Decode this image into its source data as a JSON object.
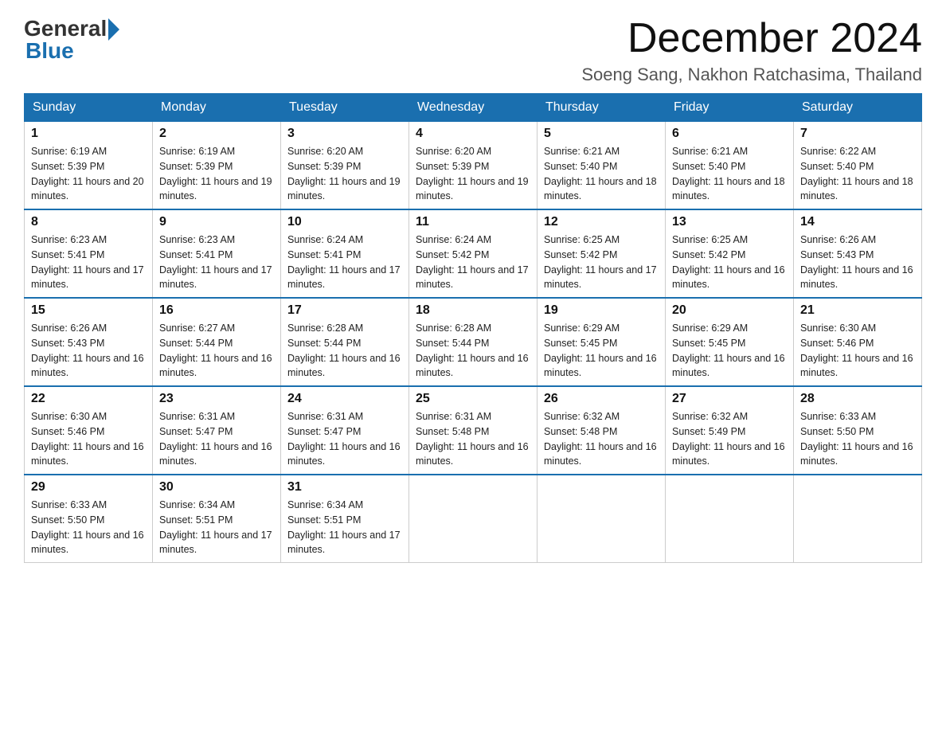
{
  "logo": {
    "general": "General",
    "blue": "Blue"
  },
  "header": {
    "title": "December 2024",
    "subtitle": "Soeng Sang, Nakhon Ratchasima, Thailand"
  },
  "days_of_week": [
    "Sunday",
    "Monday",
    "Tuesday",
    "Wednesday",
    "Thursday",
    "Friday",
    "Saturday"
  ],
  "weeks": [
    [
      {
        "day": "1",
        "sunrise": "6:19 AM",
        "sunset": "5:39 PM",
        "daylight": "11 hours and 20 minutes."
      },
      {
        "day": "2",
        "sunrise": "6:19 AM",
        "sunset": "5:39 PM",
        "daylight": "11 hours and 19 minutes."
      },
      {
        "day": "3",
        "sunrise": "6:20 AM",
        "sunset": "5:39 PM",
        "daylight": "11 hours and 19 minutes."
      },
      {
        "day": "4",
        "sunrise": "6:20 AM",
        "sunset": "5:39 PM",
        "daylight": "11 hours and 19 minutes."
      },
      {
        "day": "5",
        "sunrise": "6:21 AM",
        "sunset": "5:40 PM",
        "daylight": "11 hours and 18 minutes."
      },
      {
        "day": "6",
        "sunrise": "6:21 AM",
        "sunset": "5:40 PM",
        "daylight": "11 hours and 18 minutes."
      },
      {
        "day": "7",
        "sunrise": "6:22 AM",
        "sunset": "5:40 PM",
        "daylight": "11 hours and 18 minutes."
      }
    ],
    [
      {
        "day": "8",
        "sunrise": "6:23 AM",
        "sunset": "5:41 PM",
        "daylight": "11 hours and 17 minutes."
      },
      {
        "day": "9",
        "sunrise": "6:23 AM",
        "sunset": "5:41 PM",
        "daylight": "11 hours and 17 minutes."
      },
      {
        "day": "10",
        "sunrise": "6:24 AM",
        "sunset": "5:41 PM",
        "daylight": "11 hours and 17 minutes."
      },
      {
        "day": "11",
        "sunrise": "6:24 AM",
        "sunset": "5:42 PM",
        "daylight": "11 hours and 17 minutes."
      },
      {
        "day": "12",
        "sunrise": "6:25 AM",
        "sunset": "5:42 PM",
        "daylight": "11 hours and 17 minutes."
      },
      {
        "day": "13",
        "sunrise": "6:25 AM",
        "sunset": "5:42 PM",
        "daylight": "11 hours and 16 minutes."
      },
      {
        "day": "14",
        "sunrise": "6:26 AM",
        "sunset": "5:43 PM",
        "daylight": "11 hours and 16 minutes."
      }
    ],
    [
      {
        "day": "15",
        "sunrise": "6:26 AM",
        "sunset": "5:43 PM",
        "daylight": "11 hours and 16 minutes."
      },
      {
        "day": "16",
        "sunrise": "6:27 AM",
        "sunset": "5:44 PM",
        "daylight": "11 hours and 16 minutes."
      },
      {
        "day": "17",
        "sunrise": "6:28 AM",
        "sunset": "5:44 PM",
        "daylight": "11 hours and 16 minutes."
      },
      {
        "day": "18",
        "sunrise": "6:28 AM",
        "sunset": "5:44 PM",
        "daylight": "11 hours and 16 minutes."
      },
      {
        "day": "19",
        "sunrise": "6:29 AM",
        "sunset": "5:45 PM",
        "daylight": "11 hours and 16 minutes."
      },
      {
        "day": "20",
        "sunrise": "6:29 AM",
        "sunset": "5:45 PM",
        "daylight": "11 hours and 16 minutes."
      },
      {
        "day": "21",
        "sunrise": "6:30 AM",
        "sunset": "5:46 PM",
        "daylight": "11 hours and 16 minutes."
      }
    ],
    [
      {
        "day": "22",
        "sunrise": "6:30 AM",
        "sunset": "5:46 PM",
        "daylight": "11 hours and 16 minutes."
      },
      {
        "day": "23",
        "sunrise": "6:31 AM",
        "sunset": "5:47 PM",
        "daylight": "11 hours and 16 minutes."
      },
      {
        "day": "24",
        "sunrise": "6:31 AM",
        "sunset": "5:47 PM",
        "daylight": "11 hours and 16 minutes."
      },
      {
        "day": "25",
        "sunrise": "6:31 AM",
        "sunset": "5:48 PM",
        "daylight": "11 hours and 16 minutes."
      },
      {
        "day": "26",
        "sunrise": "6:32 AM",
        "sunset": "5:48 PM",
        "daylight": "11 hours and 16 minutes."
      },
      {
        "day": "27",
        "sunrise": "6:32 AM",
        "sunset": "5:49 PM",
        "daylight": "11 hours and 16 minutes."
      },
      {
        "day": "28",
        "sunrise": "6:33 AM",
        "sunset": "5:50 PM",
        "daylight": "11 hours and 16 minutes."
      }
    ],
    [
      {
        "day": "29",
        "sunrise": "6:33 AM",
        "sunset": "5:50 PM",
        "daylight": "11 hours and 16 minutes."
      },
      {
        "day": "30",
        "sunrise": "6:34 AM",
        "sunset": "5:51 PM",
        "daylight": "11 hours and 17 minutes."
      },
      {
        "day": "31",
        "sunrise": "6:34 AM",
        "sunset": "5:51 PM",
        "daylight": "11 hours and 17 minutes."
      },
      null,
      null,
      null,
      null
    ]
  ]
}
